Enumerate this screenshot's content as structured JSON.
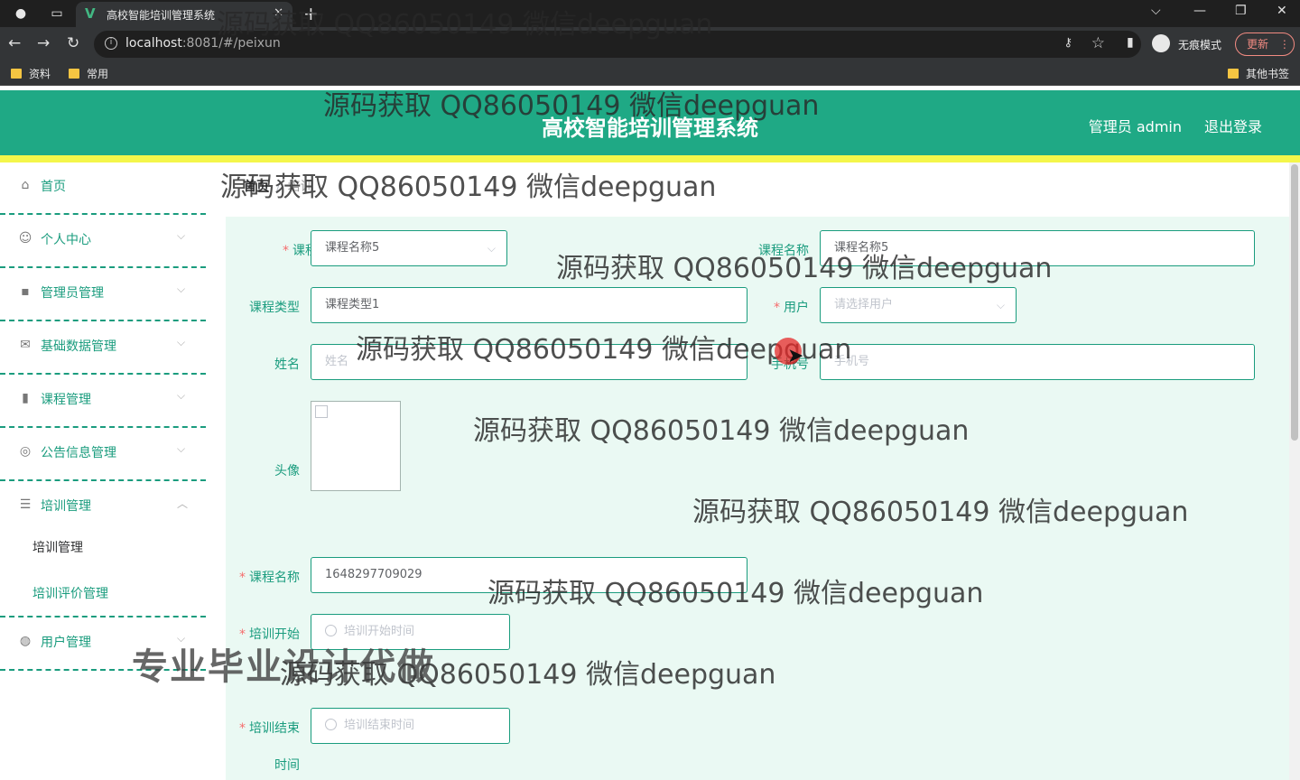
{
  "browser": {
    "tab_title": "高校智能培训管理系统",
    "tab_favicon": "V",
    "url_host": "localhost",
    "url_rest": ":8081/#/peixun",
    "incognito_label": "无痕模式",
    "update_label": "更新",
    "bookmarks": [
      "资料",
      "常用"
    ],
    "other_bookmarks": "其他书签",
    "icons": {
      "back": "←",
      "forward": "→",
      "reload": "↻",
      "close": "✕",
      "new_tab": "+",
      "minimize": "—",
      "restore": "❐",
      "dropdown": "⌵",
      "star": "☆",
      "key": "⚷",
      "menu": "⋮",
      "sidebar": "▮",
      "info": "i",
      "world": "●",
      "window": "▭"
    }
  },
  "header": {
    "title": "高校智能培训管理系统",
    "user": "管理员 admin",
    "logout": "退出登录",
    "bg_color": "#1fa985",
    "accent_color": "#f4f64a"
  },
  "sidebar": {
    "items": [
      {
        "label": "首页",
        "icon": "⌂"
      },
      {
        "label": "个人中心",
        "icon": "☺"
      },
      {
        "label": "管理员管理",
        "icon": "▪"
      },
      {
        "label": "基础数据管理",
        "icon": "✉"
      },
      {
        "label": "课程管理",
        "icon": "▮"
      },
      {
        "label": "公告信息管理",
        "icon": "◎"
      },
      {
        "label": "培训管理",
        "icon": "☰"
      },
      {
        "label": "用户管理",
        "icon": "◍"
      }
    ],
    "caret_down": "⌵",
    "caret_up": "︿",
    "sub_items": [
      "培训管理",
      "培训评价管理"
    ],
    "accent_color": "#1a9c7e"
  },
  "breadcrumb": {
    "home": "首页",
    "separator": "/",
    "current": "培训"
  },
  "form": {
    "course_label": "课程",
    "course_value": "课程名称5",
    "course_name_label": "课程名称",
    "course_name_value": "课程名称5",
    "course_type_label": "课程类型",
    "course_type_value": "课程类型1",
    "user_label": "用户",
    "user_placeholder": "请选择用户",
    "name_label": "姓名",
    "name_placeholder": "姓名",
    "phone_label": "手机号",
    "phone_placeholder": "手机号",
    "avatar_label": "头像",
    "training_name_label": "课程名称",
    "training_name_value": "1648297709029",
    "start_label": "培训开始",
    "start_placeholder": "培训开始时间",
    "end_label": "培训结束",
    "end_label_line2": "时间",
    "end_placeholder": "培训结束时间",
    "required_mark": "*",
    "bg_color": "#eaf9f3"
  },
  "overlays": {
    "watermark": "源码获取 QQ86050149 微信deepguan",
    "promo": "专业毕业设计代做"
  }
}
